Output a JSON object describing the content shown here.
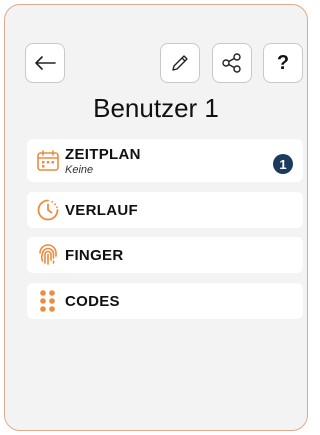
{
  "header": {
    "title": "Benutzer 1",
    "help_label": "?"
  },
  "menu": {
    "schedule": {
      "label": "ZEITPLAN",
      "sublabel": "Keine",
      "badge": "1",
      "icon": "calendar-icon"
    },
    "history": {
      "label": "VERLAUF",
      "icon": "clock-history-icon"
    },
    "finger": {
      "label": "FINGER",
      "icon": "fingerprint-icon"
    },
    "codes": {
      "label": "CODES",
      "icon": "keypad-icon"
    }
  },
  "colors": {
    "accent": "#f08a3c",
    "badge": "#1b3a5e",
    "card_border": "#e2a98a",
    "background": "#f3f3f4"
  }
}
